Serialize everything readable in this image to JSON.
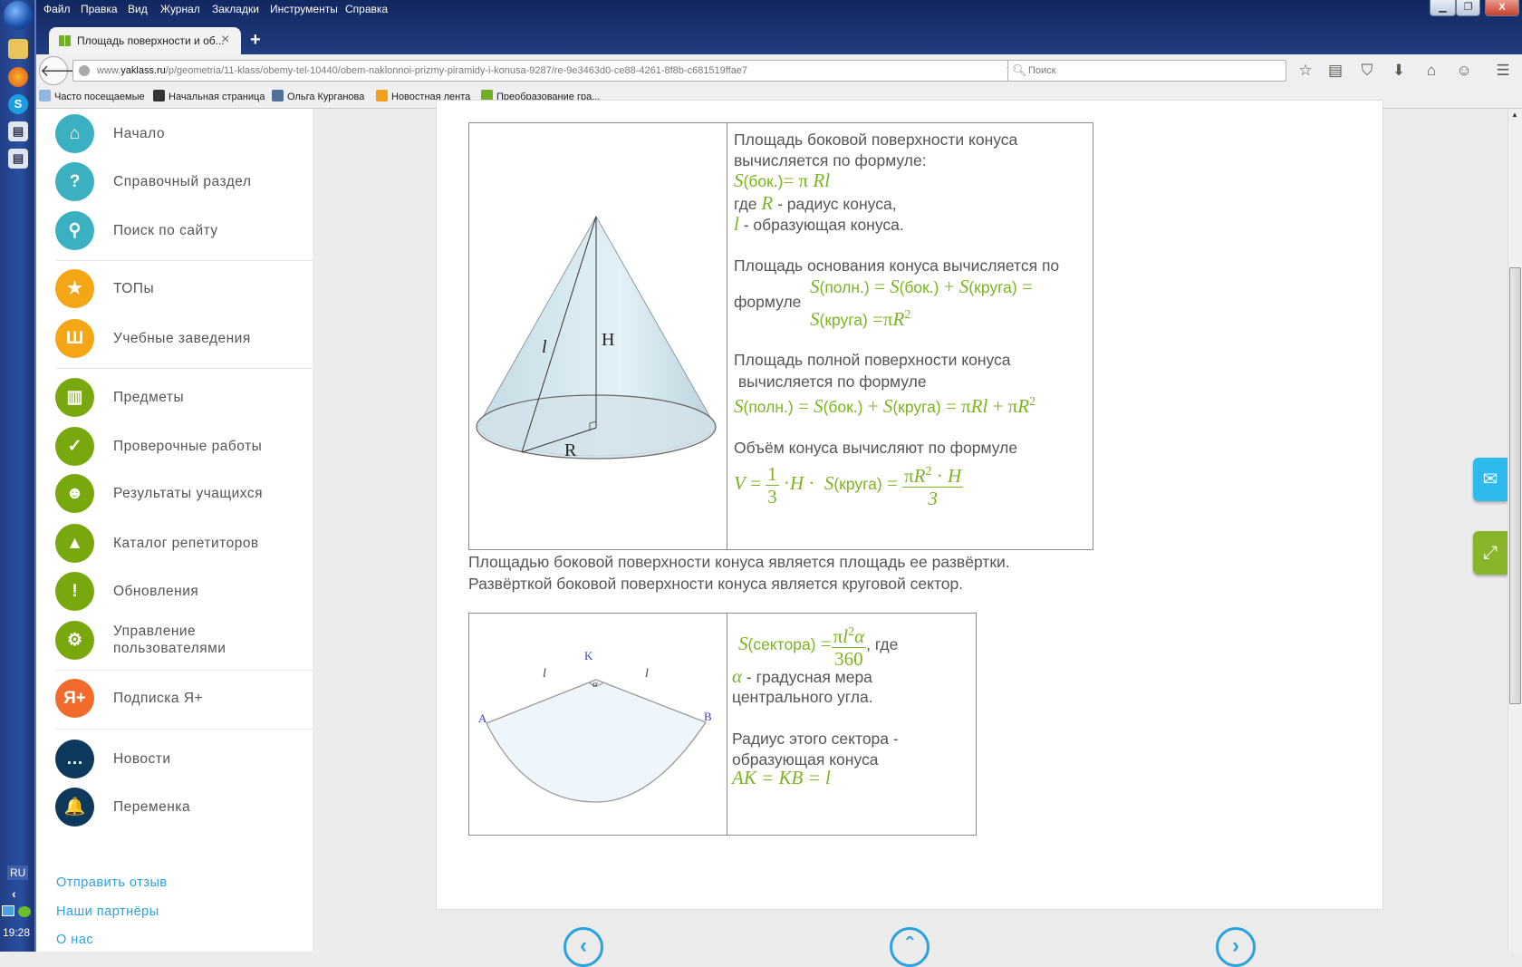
{
  "taskbar": {
    "language": "RU",
    "clock": "19:28"
  },
  "menu": [
    "Файл",
    "Правка",
    "Вид",
    "Журнал",
    "Закладки",
    "Инструменты",
    "Справка"
  ],
  "tab": {
    "title": "Площадь поверхности и об...",
    "close": "×",
    "new_tab": "+"
  },
  "url": {
    "prefix": "www.",
    "domain": "yaklass.ru",
    "path": "/p/geometria/11-klass/obemy-tel-10440/obem-naklonnoi-prizmy-piramidy-i-konusa-9287/re-9e3463d0-ce88-4261-8f8b-c681519ffae7"
  },
  "search": {
    "placeholder": "Поиск"
  },
  "bookmarks": [
    "Часто посещаемые",
    "Начальная страница",
    "Ольга Курганова",
    "Новостная лента",
    "Преобразование гра..."
  ],
  "sidebar": {
    "items": [
      {
        "label": "Начало",
        "icon": "⌂",
        "color": "#3ab0c0"
      },
      {
        "label": "Справочный раздел",
        "icon": "?",
        "color": "#3ab0c0"
      },
      {
        "label": "Поиск по сайту",
        "icon": "⚲",
        "color": "#3ab0c0"
      },
      {
        "label": "ТОПы",
        "icon": "★",
        "color": "#f5a614"
      },
      {
        "label": "Учебные заведения",
        "icon": "Ш",
        "color": "#f5a614"
      },
      {
        "label": "Предметы",
        "icon": "▥",
        "color": "#78a80d"
      },
      {
        "label": "Проверочные работы",
        "icon": "✓",
        "color": "#78a80d"
      },
      {
        "label": "Результаты учащихся",
        "icon": "☻",
        "color": "#78a80d"
      },
      {
        "label": "Каталог репетиторов",
        "icon": "▲",
        "color": "#78a80d"
      },
      {
        "label": "Обновления",
        "icon": "!",
        "color": "#78a80d"
      },
      {
        "label": "Управление пользователями",
        "icon": "⚙",
        "color": "#78a80d"
      },
      {
        "label": "Подписка Я+",
        "icon": "Я+",
        "color": "#f26b2a"
      },
      {
        "label": "Новости",
        "icon": "…",
        "color": "#0d3a5c"
      },
      {
        "label": "Переменка",
        "icon": "🔔",
        "color": "#0d3a5c"
      }
    ],
    "footer": [
      "Отправить отзыв",
      "Наши партнёры",
      "О нас"
    ]
  },
  "cone": {
    "labels": {
      "l": "l",
      "H": "H",
      "R": "R"
    }
  },
  "theory": {
    "p1": [
      "Площадь боковой поверхности конуса",
      "вычисляется по формуле:"
    ],
    "f_lateral": {
      "S": "S",
      "arg": "(бок.)",
      "eq": "= π ",
      "rl": "Rl"
    },
    "where_r": {
      "pre": "где ",
      "R": "R",
      "post": " - радиус конуса,"
    },
    "where_l": {
      "l": "l",
      "post": " - образующая конуса."
    },
    "p2": "Площадь основания конуса вычисляется  по",
    "p2_word": "формуле",
    "f_full_1": {
      "s1": "S",
      "a1": "(полн.)",
      "e1": " = ",
      "s2": "S",
      "a2": "(бок.)",
      "e2": " + ",
      "s3": "S",
      "a3": "(круга)",
      "e3": " ="
    },
    "f_base": {
      "s": "S",
      "a": "(круга)",
      "e": " =π",
      "r": "R",
      "sup": "2"
    },
    "p3": [
      "Площадь полной поверхности конуса",
      " вычисляется по формуле"
    ],
    "f_full": {
      "s1": "S",
      "a1": "(полн.)",
      "e1": " = ",
      "s2": "S",
      "a2": "(бок.)",
      "e2": " + ",
      "s3": "S",
      "a3": "(круга)",
      "e3": " = π",
      "rl": "Rl",
      "e4": " + π",
      "r": "R",
      "sup": "2"
    },
    "p4": "Объём конуса вычисляют по формуле",
    "f_volume": {
      "v": "V",
      "e1": " = ",
      "n1": "1",
      "d1": "3",
      "dot": " ·",
      "h": "H",
      "dot2": " ·  ",
      "s": "S",
      "a": "(круга)",
      "e2": " = ",
      "num_pi": "π",
      "num_r": "R",
      "num_sup": "2",
      "num_dot": " · ",
      "num_h": "H",
      "den": "3"
    }
  },
  "paragraph": [
    "Площадью боковой поверхности конуса является площадь ее развёртки.",
    "Развёрткой боковой поверхности конуса является круговой сектор."
  ],
  "sector": {
    "labels": {
      "K": "K",
      "A": "A",
      "B": "B",
      "l1": "l",
      "l2": "l",
      "alpha": "α"
    }
  },
  "sector_text": {
    "f": {
      "s": "S",
      "a": "(сектора)",
      "e": " =",
      "num_pi": "π",
      "num_l": "l",
      "num_sup": "2",
      "num_a": "α",
      "den": "360",
      "post": ", где"
    },
    "alpha": {
      "a": "α",
      "post": " - градусная мера"
    },
    "alpha2": "центрального угла.",
    "radius": [
      "Радиус этого сектора -",
      "образующая конуса"
    ],
    "eq": "AK = KB = l"
  },
  "nav": {
    "prev": "‹",
    "up": "ˆ",
    "next": "›"
  },
  "colors": {
    "accent_green": "#7ab51d",
    "link_blue": "#2aa2e0",
    "mail_button": "#2dbaed",
    "expand_button": "#8ab42c"
  }
}
